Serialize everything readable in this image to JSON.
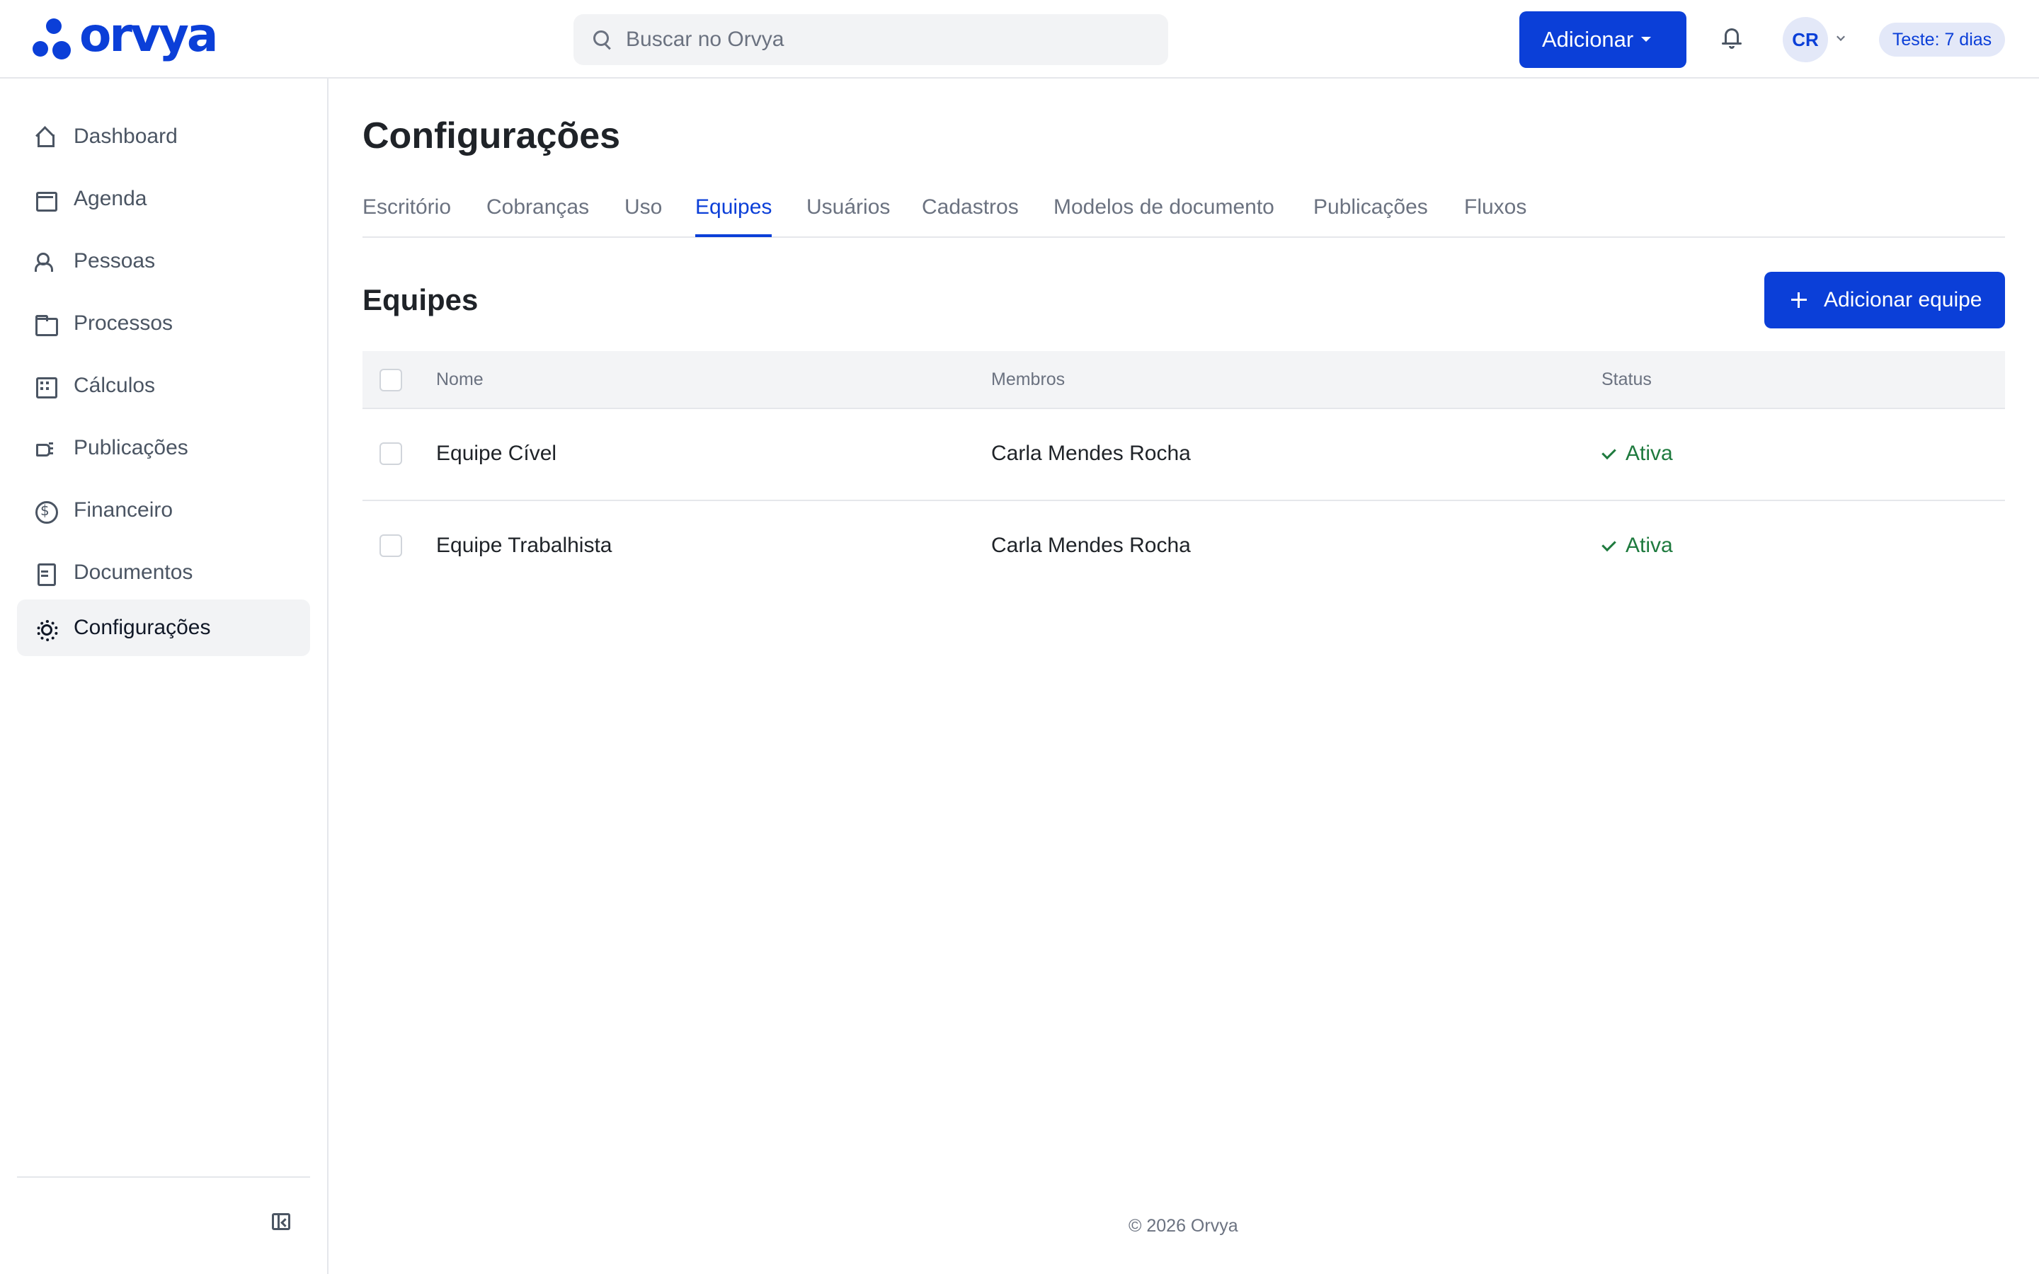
{
  "brand": {
    "name": "orvya",
    "accent": "#0b3fd8"
  },
  "header": {
    "search_placeholder": "Buscar no Orvya",
    "add_button": "Adicionar",
    "avatar_initials": "CR",
    "trial_badge": "Teste: 7 dias"
  },
  "sidebar": {
    "items": [
      {
        "label": "Dashboard",
        "icon": "home-icon"
      },
      {
        "label": "Agenda",
        "icon": "calendar-icon"
      },
      {
        "label": "Pessoas",
        "icon": "people-icon"
      },
      {
        "label": "Processos",
        "icon": "folder-icon"
      },
      {
        "label": "Cálculos",
        "icon": "calculator-icon"
      },
      {
        "label": "Publicações",
        "icon": "megaphone-icon"
      },
      {
        "label": "Financeiro",
        "icon": "dollar-circle-icon"
      },
      {
        "label": "Documentos",
        "icon": "document-icon"
      },
      {
        "label": "Configurações",
        "icon": "gear-icon",
        "active": true
      }
    ]
  },
  "page": {
    "title": "Configurações",
    "tabs": [
      "Escritório",
      "Cobranças",
      "Uso",
      "Equipes",
      "Usuários",
      "Cadastros",
      "Modelos de documento",
      "Publicações",
      "Fluxos"
    ],
    "active_tab": "Equipes"
  },
  "section": {
    "title": "Equipes",
    "add_button": "Adicionar equipe"
  },
  "table": {
    "columns": [
      "Nome",
      "Membros",
      "Status"
    ],
    "rows": [
      {
        "name": "Equipe Cível",
        "members": "Carla Mendes Rocha",
        "status": "Ativa"
      },
      {
        "name": "Equipe Trabalhista",
        "members": "Carla Mendes Rocha",
        "status": "Ativa"
      }
    ]
  },
  "footer": {
    "text": "© 2026 Orvya"
  }
}
